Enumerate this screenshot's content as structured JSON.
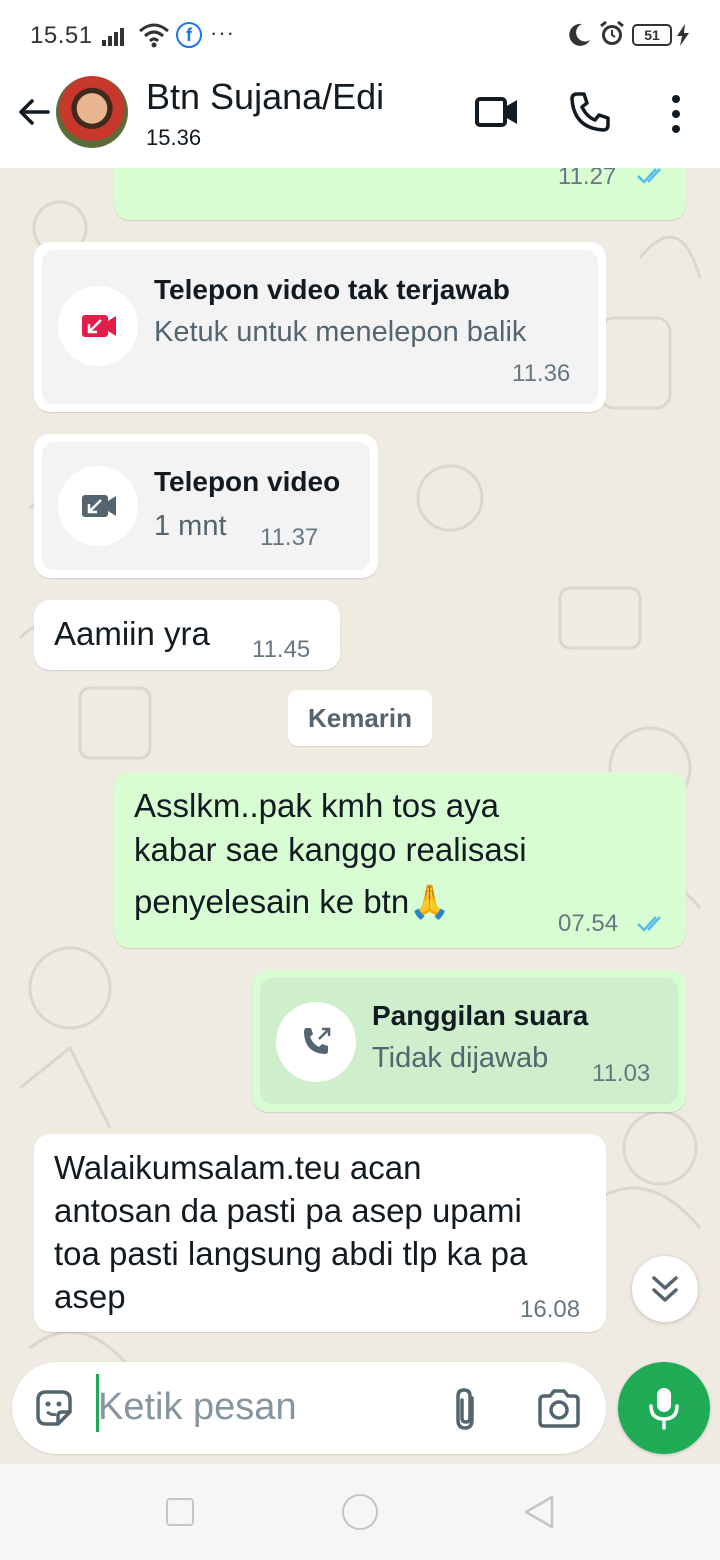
{
  "status_bar": {
    "time": "15.51",
    "battery_level": "51",
    "icons": [
      "signal-icon",
      "wifi-icon",
      "facebook-icon",
      "more-notifications-icon",
      "do-not-disturb-icon",
      "alarm-icon",
      "battery-icon",
      "charging-icon"
    ]
  },
  "header": {
    "contact_name": "Btn Sujana/Edi",
    "subtitle": "15.36",
    "icons": [
      "back-arrow-icon",
      "video-call-icon",
      "voice-call-icon",
      "more-vertical-icon"
    ]
  },
  "messages": [
    {
      "direction": "out",
      "type": "text_partial",
      "text": "",
      "time": "11.27",
      "read": true
    },
    {
      "direction": "in",
      "type": "call",
      "call_title": "Telepon video tak terjawab",
      "call_subtitle": "Ketuk untuk menelepon balik",
      "time": "11.36",
      "icon": "missed-video-call-icon",
      "icon_color": "#e11d48"
    },
    {
      "direction": "in",
      "type": "call",
      "call_title": "Telepon video",
      "call_subtitle": "1 mnt",
      "time": "11.37",
      "icon": "incoming-video-call-icon",
      "icon_color": "#54656f"
    },
    {
      "direction": "in",
      "type": "text",
      "text": "Aamiin yra",
      "time": "11.45"
    },
    {
      "direction": "out",
      "type": "text",
      "lines": [
        "Asslkm..pak kmh tos aya",
        "kabar sae kanggo realisasi",
        "penyelesain ke btn🙏"
      ],
      "time": "07.54",
      "read": true
    },
    {
      "direction": "out",
      "type": "call",
      "call_title": "Panggilan suara",
      "call_subtitle": "Tidak dijawab",
      "time": "11.03",
      "icon": "outgoing-voice-call-icon",
      "icon_color": "#54656f"
    },
    {
      "direction": "in",
      "type": "text",
      "lines": [
        "Walaikumsalam.teu acan",
        "antosan da pasti pa asep upami",
        "toa pasti langsung abdi tlp ka pa",
        "asep"
      ],
      "time": "16.08"
    }
  ],
  "date_separator": "Kemarin",
  "composer": {
    "placeholder": "Ketik pesan",
    "value": ""
  },
  "colors": {
    "outgoing_bubble": "#d9fdd3",
    "incoming_bubble": "#ffffff",
    "chat_background": "#efeae2",
    "accent_green": "#1faa55",
    "read_ticks": "#53bdeb",
    "missed_call": "#e11d48"
  }
}
